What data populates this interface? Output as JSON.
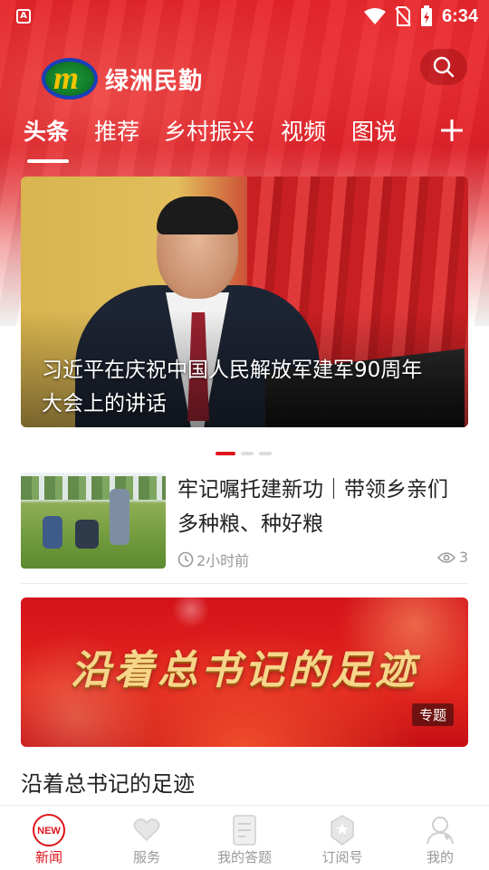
{
  "status_bar": {
    "app_icon_letter": "A",
    "time": "6:34"
  },
  "header": {
    "logo_text": "绿洲民勤",
    "search_icon": "search-icon",
    "tabs": [
      {
        "label": "头条",
        "active": true
      },
      {
        "label": "推荐",
        "active": false
      },
      {
        "label": "乡村振兴",
        "active": false
      },
      {
        "label": "视频",
        "active": false
      },
      {
        "label": "图说",
        "active": false
      }
    ],
    "add_channel_icon": "plus-icon"
  },
  "carousel": {
    "caption": "习近平在庆祝中国人民解放军建军90周年大会上的讲话",
    "slide_count": 3,
    "active_index": 0
  },
  "news": [
    {
      "title": "牢记嘱托建新功｜带领乡亲们多种粮、种好粮",
      "time": "2小时前",
      "views": "3"
    }
  ],
  "topic": {
    "banner_title": "沿着总书记的足迹",
    "badge": "专题",
    "caption": "沿着总书记的足迹"
  },
  "tabbar": [
    {
      "label": "新闻",
      "icon": "news-icon",
      "active": true
    },
    {
      "label": "服务",
      "icon": "service-icon",
      "active": false
    },
    {
      "label": "我的答题",
      "icon": "quiz-icon",
      "active": false
    },
    {
      "label": "订阅号",
      "icon": "subscription-icon",
      "active": false
    },
    {
      "label": "我的",
      "icon": "profile-icon",
      "active": false
    }
  ],
  "colors": {
    "brand_red": "#e0141b",
    "inactive_gray": "#999999",
    "text_dark": "#222222"
  }
}
